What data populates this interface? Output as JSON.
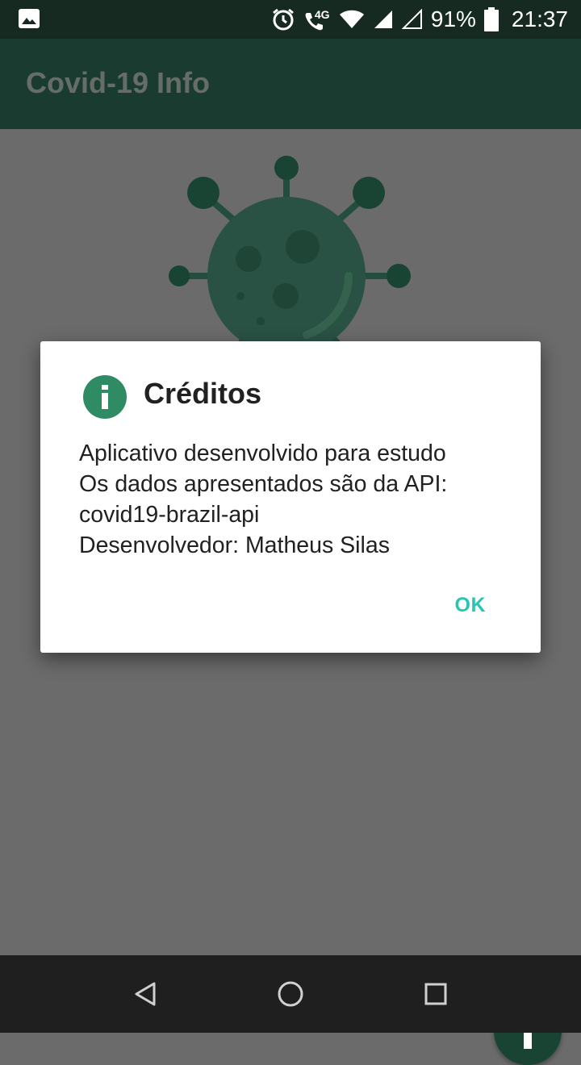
{
  "status_bar": {
    "battery": "91%",
    "time": "21:37",
    "network_label": "4G",
    "icons": [
      "image-icon",
      "alarm-icon",
      "volte-call-icon",
      "wifi-icon",
      "signal-icon",
      "signal-empty-icon",
      "battery-icon"
    ]
  },
  "app_bar": {
    "title": "Covid-19 Info"
  },
  "dialog": {
    "title": "Créditos",
    "lines": [
      "Aplicativo desenvolvido para estudo",
      "Os dados apresentados são da API:",
      "covid19-brazil-api",
      "Desenvolvedor: Matheus Silas"
    ],
    "ok_label": "OK",
    "icon": "info-icon"
  },
  "fab": {
    "icon": "info-icon"
  },
  "nav_bar": {
    "icons": [
      "back-icon",
      "home-icon",
      "recents-icon"
    ]
  },
  "colors": {
    "status_bar": "#172a22",
    "app_bar": "#193b30",
    "scrim": "#6b6b6b",
    "accent": "#26c6b4",
    "dialog_icon": "#2f8b64",
    "fab": "#194434"
  }
}
